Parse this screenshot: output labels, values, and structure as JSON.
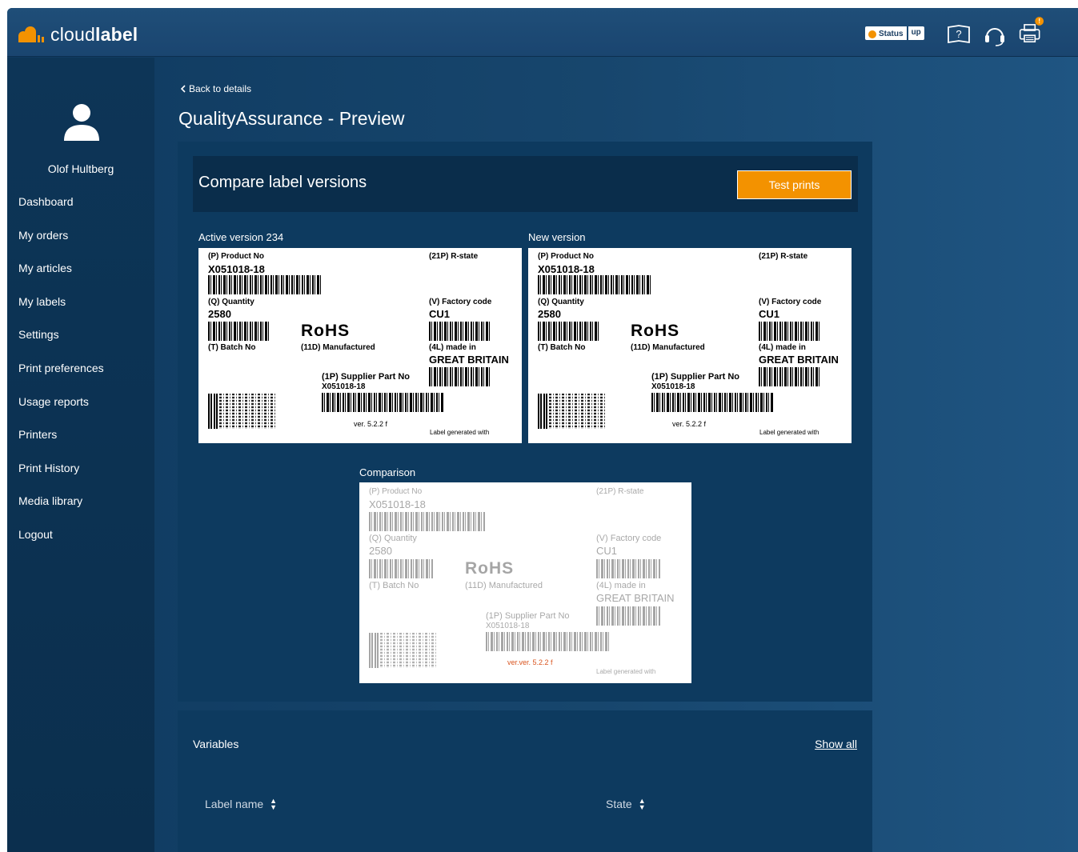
{
  "header": {
    "brand_light": "cloud",
    "brand_bold": "label",
    "status_label": "Status",
    "status_value": "up",
    "icons": [
      "help-book-icon",
      "support-headset-icon",
      "printer-alert-icon"
    ]
  },
  "sidebar": {
    "user_name": "Olof Hultberg",
    "items": [
      {
        "label": "Dashboard"
      },
      {
        "label": "My orders"
      },
      {
        "label": "My articles"
      },
      {
        "label": "My labels"
      },
      {
        "label": "Settings"
      },
      {
        "label": "Print preferences"
      },
      {
        "label": "Usage reports"
      },
      {
        "label": "Printers"
      },
      {
        "label": "Print History"
      },
      {
        "label": "Media library"
      },
      {
        "label": "Logout"
      }
    ]
  },
  "main": {
    "back_link": "Back to details",
    "page_title": "QualityAssurance - Preview",
    "compare_title": "Compare label versions",
    "test_prints_button": "Test prints",
    "active_version_label": "Active version 234",
    "new_version_label": "New version",
    "comparison_label": "Comparison"
  },
  "label": {
    "product_no_caption": "(P) Product No",
    "product_no": "X051018-18",
    "rstate_caption": "(21P) R-state",
    "quantity_caption": "(Q) Quantity",
    "quantity": "2580",
    "factory_caption": "(V) Factory code",
    "factory_code": "CU1",
    "rohs": "RoHS",
    "batch_caption": "(T) Batch No",
    "manufactured_caption": "(11D) Manufactured",
    "made_in_caption": "(4L) made in",
    "made_in": "GREAT BRITAIN",
    "supplier_caption": "(1P) Supplier Part No",
    "supplier_no": "X051018-18",
    "version": "ver. 5.2.2 f",
    "generated": "Label generated with"
  },
  "comparison": {
    "version_diff": "ver.ver. 5.2.2 f"
  },
  "variables": {
    "title": "Variables",
    "show_all": "Show all",
    "columns": [
      "Label name",
      "State"
    ]
  },
  "colors": {
    "accent": "#f39200",
    "background": "#17466d",
    "panel": "#0d3a5f",
    "diff_text": "#d9541e"
  }
}
